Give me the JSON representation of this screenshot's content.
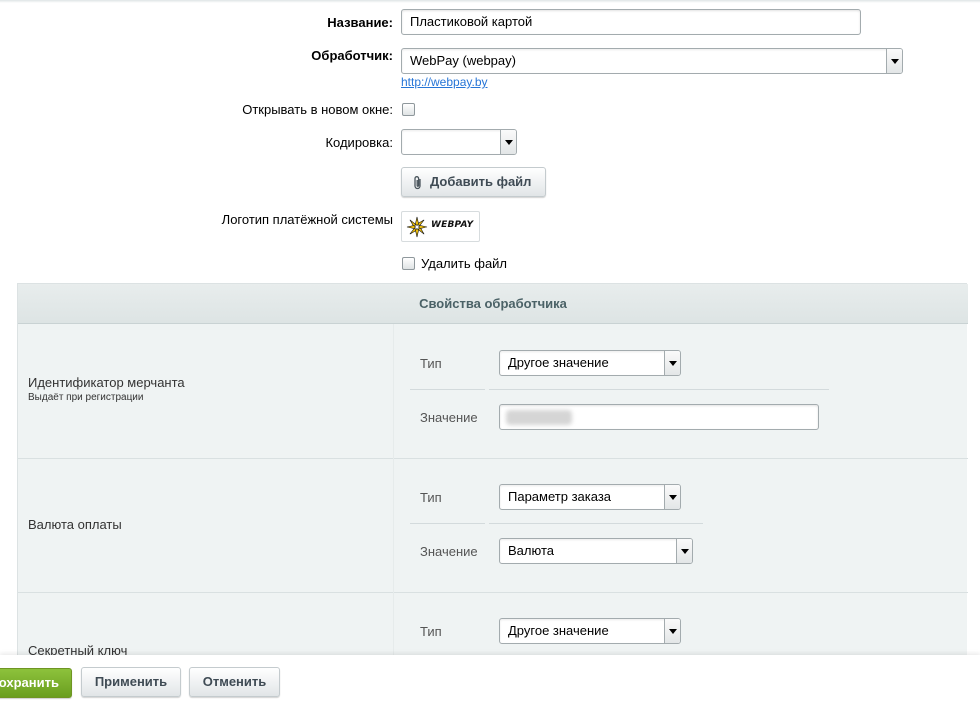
{
  "form": {
    "name_label": "Название:",
    "name_value": "Пластиковой картой",
    "handler_label": "Обработчик:",
    "handler_value": "WebPay (webpay)",
    "handler_link": "http://webpay.by",
    "new_window_label": "Открывать в новом окне:",
    "new_window_checked": false,
    "encoding_label": "Кодировка:",
    "encoding_value": "",
    "add_file_button": "Добавить файл",
    "logo_label": "Логотип платёжной системы",
    "logo_text": "WEBPAY",
    "delete_file_label": "Удалить файл",
    "delete_file_checked": false
  },
  "properties": {
    "title": "Свойства обработчика",
    "type_label": "Тип",
    "value_label": "Значение",
    "items": [
      {
        "name": "Идентификатор мерчанта",
        "subtitle": "Выдаёт при регистрации",
        "type_value": "Другое значение",
        "value": ""
      },
      {
        "name": "Валюта оплаты",
        "type_value": "Параметр заказа",
        "value": "Валюта"
      },
      {
        "name": "Секретный ключ",
        "type_value": "Другое значение"
      }
    ]
  },
  "footer": {
    "save_label": "охранить",
    "apply_label": "Применить",
    "cancel_label": "Отменить"
  },
  "colors": {
    "save_button": "#7ab02e",
    "link": "#2675d7",
    "panel_bg": "#eff3f3"
  }
}
